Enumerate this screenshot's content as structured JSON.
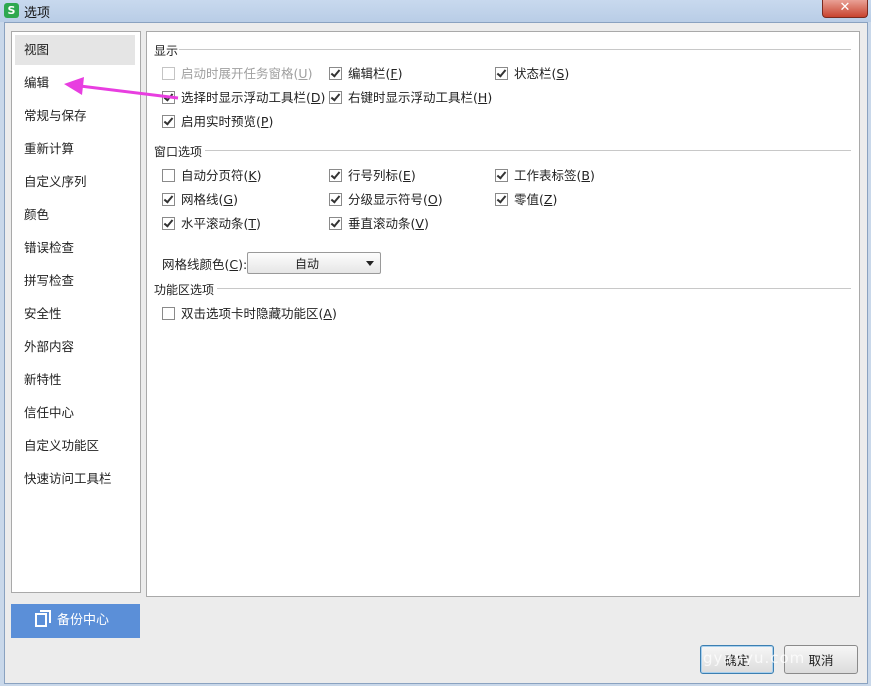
{
  "window": {
    "title": "选项",
    "app_icon": "S",
    "close_label": "✕"
  },
  "sidebar": {
    "items": [
      {
        "label": "视图",
        "active": true
      },
      {
        "label": "编辑"
      },
      {
        "label": "常规与保存"
      },
      {
        "label": "重新计算"
      },
      {
        "label": "自定义序列"
      },
      {
        "label": "颜色"
      },
      {
        "label": "错误检查"
      },
      {
        "label": "拼写检查"
      },
      {
        "label": "安全性"
      },
      {
        "label": "外部内容"
      },
      {
        "label": "新特性"
      },
      {
        "label": "信任中心"
      },
      {
        "label": "自定义功能区"
      },
      {
        "label": "快速访问工具栏"
      }
    ],
    "backup_label": "备份中心"
  },
  "display": {
    "title": "显示",
    "options": [
      {
        "text": "启动时展开任务窗格",
        "key": "U",
        "checked": false,
        "disabled": true
      },
      {
        "text": "编辑栏",
        "key": "F",
        "checked": true
      },
      {
        "text": "状态栏",
        "key": "S",
        "checked": true
      },
      {
        "text": "选择时显示浮动工具栏",
        "key": "D",
        "checked": true
      },
      {
        "text": "右键时显示浮动工具栏",
        "key": "H",
        "checked": true
      },
      {
        "text": "启用实时预览",
        "key": "P",
        "checked": true
      }
    ]
  },
  "window_options": {
    "title": "窗口选项",
    "options": [
      {
        "text": "自动分页符",
        "key": "K",
        "checked": false
      },
      {
        "text": "行号列标",
        "key": "E",
        "checked": true
      },
      {
        "text": "工作表标签",
        "key": "B",
        "checked": true
      },
      {
        "text": "网格线",
        "key": "G",
        "checked": true
      },
      {
        "text": "分级显示符号",
        "key": "O",
        "checked": true
      },
      {
        "text": "零值",
        "key": "Z",
        "checked": true
      },
      {
        "text": "水平滚动条",
        "key": "T",
        "checked": true
      },
      {
        "text": "垂直滚动条",
        "key": "V",
        "checked": true
      }
    ],
    "gridline_color_label": "网格线颜色(",
    "gridline_color_key": "C",
    "gridline_color_suffix": "):",
    "gridline_color_value": "自动"
  },
  "ribbon_options": {
    "title": "功能区选项",
    "options": [
      {
        "text": "双击选项卡时隐藏功能区",
        "key": "A",
        "checked": false
      }
    ]
  },
  "buttons": {
    "ok": "确定",
    "cancel": "取消"
  },
  "watermark": "gyanyu.com",
  "colors": {
    "accent_backup": "#5b8fd8",
    "annotation_arrow": "#e83ee0"
  }
}
